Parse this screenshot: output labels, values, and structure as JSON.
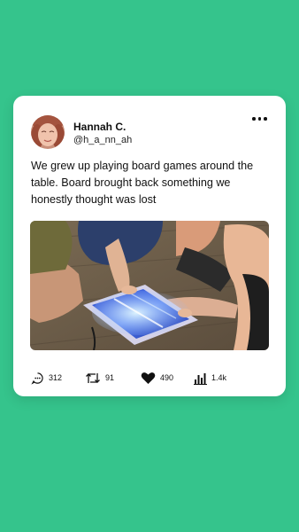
{
  "post": {
    "author_name": "Hannah C.",
    "author_handle": "@h_a_nn_ah",
    "text": "We grew up playing board games around the table. Board brought back something we honestly thought was lost",
    "more_icon": "more-horizontal-icon",
    "image_alt": "Family gathered around a glowing digital game board on the floor"
  },
  "stats": {
    "replies": "312",
    "reposts": "91",
    "likes": "490",
    "views": "1.4k"
  },
  "icons": {
    "replies": "comment-icon",
    "reposts": "repost-icon",
    "likes": "heart-icon",
    "views": "bar-chart-icon"
  },
  "colors": {
    "background": "#35c48c",
    "card": "#ffffff",
    "text": "#111111"
  }
}
